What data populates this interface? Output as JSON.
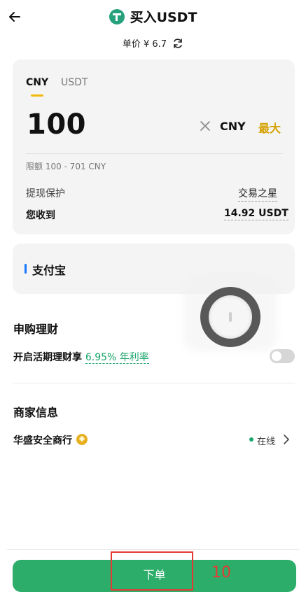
{
  "header": {
    "title": "买入USDT"
  },
  "price": {
    "label": "单价",
    "value": "¥ 6.7"
  },
  "order_card": {
    "tabs": [
      {
        "label": "CNY",
        "active": true
      },
      {
        "label": "USDT",
        "active": false
      }
    ],
    "amount": "100",
    "currency": "CNY",
    "max_label": "最大",
    "limit_text": "限额 100 - 701 CNY",
    "protection_label": "提现保护",
    "protection_value": "交易之星",
    "receive_label": "您收到",
    "receive_value": "14.92 USDT"
  },
  "payment": {
    "method": "支付宝"
  },
  "earn": {
    "section_title": "申购理财",
    "text": "开启活期理财享",
    "rate": "6.95% 年利率",
    "toggle_on": false
  },
  "merchant": {
    "section_title": "商家信息",
    "name": "华盛安全商行",
    "status": "在线"
  },
  "submit": {
    "label": "下单"
  },
  "annotation": {
    "number": "10"
  },
  "colors": {
    "accent_green": "#2cae6a",
    "accent_gold": "#d4a200",
    "annotation_red": "#e53935"
  }
}
